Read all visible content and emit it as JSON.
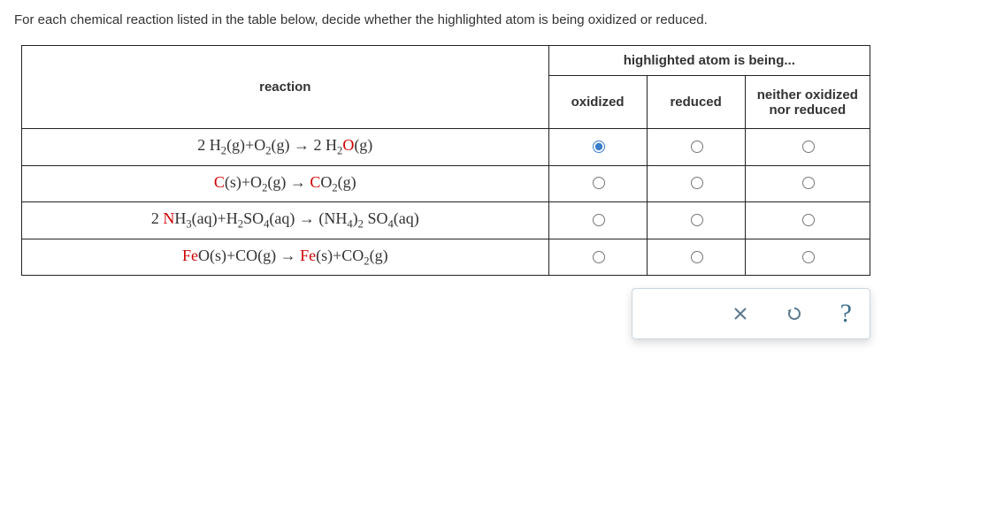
{
  "prompt": "For each chemical reaction listed in the table below, decide whether the highlighted atom is being oxidized or reduced.",
  "headers": {
    "reaction": "reaction",
    "group": "highlighted atom is being...",
    "oxidized": "oxidized",
    "reduced": "reduced",
    "neither": "neither oxidized nor reduced"
  },
  "rows": [
    {
      "reactionParts": {
        "pre": "2 H",
        "preSub1": "2",
        "preState1": "(g)",
        "mid": "+O",
        "midSub": "2",
        "midState": "(g) → 2 H",
        "postSub1": "2",
        "hl": "O",
        "postState": "(g)"
      },
      "selected": "oxidized"
    },
    {
      "reactionParts": {
        "hl": "C",
        "preState1": "(s)",
        "mid": "+O",
        "midSub": "2",
        "midState": "(g) → ",
        "hl2": "C",
        "post": "O",
        "postSub1": "2",
        "postState": "(g)"
      },
      "selected": null
    },
    {
      "reactionParts": {
        "pre": "2 ",
        "hl": "N",
        "post1": "H",
        "post1Sub": "3",
        "preState1": "(aq)",
        "mid": "+H",
        "midSub": "2",
        "mid2": "SO",
        "mid2Sub": "4",
        "midState": "(aq) → ",
        "prod": "(NH",
        "prodSub1": "4",
        "prod2": ")",
        "prodSub2": "2",
        "prod3": " SO",
        "prodSub3": "4",
        "postState": "(aq)"
      },
      "selected": null
    },
    {
      "reactionParts": {
        "hl": "Fe",
        "post1": "O(s)",
        "mid": "+CO(g) → ",
        "hl2": "Fe",
        "post2": "(s)",
        "mid2": "+CO",
        "mid2Sub": "2",
        "postState": "(g)"
      },
      "selected": null
    }
  ],
  "toolbar": {
    "clear": "clear",
    "reset": "reset",
    "help": "?"
  }
}
